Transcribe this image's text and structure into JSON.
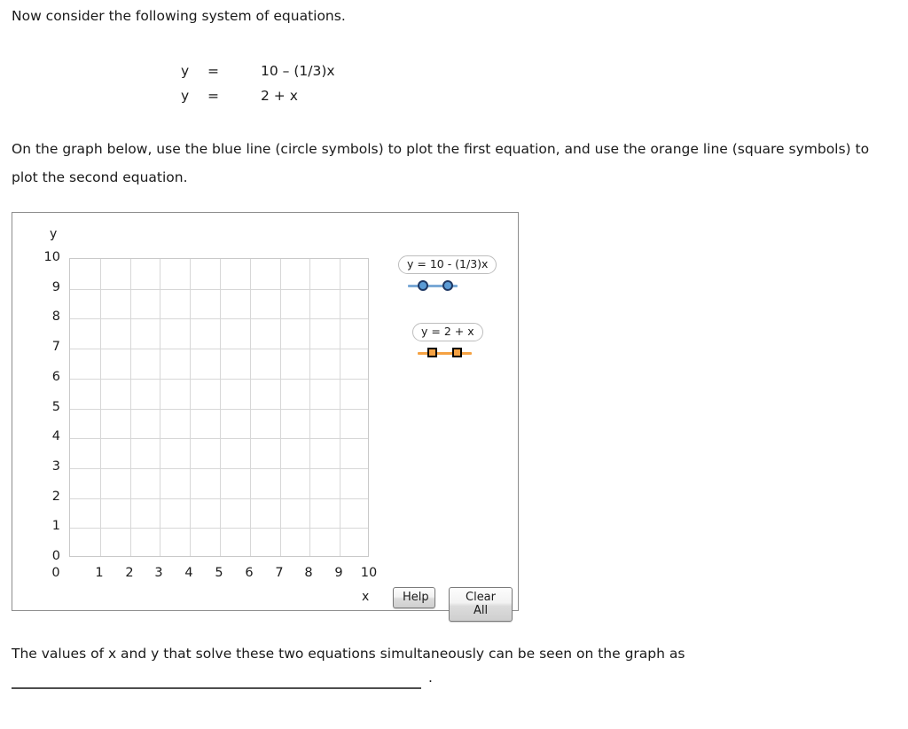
{
  "intro": {
    "text": "Now consider the following system of equations."
  },
  "equations": [
    {
      "lhs": "y",
      "eq": "=",
      "rhs": "10 – (1/3)x"
    },
    {
      "lhs": "y",
      "eq": "=",
      "rhs": "2 + x"
    }
  ],
  "instruction": {
    "text": "On the graph below, use the blue line (circle symbols) to plot the first equation, and use the orange line (square symbols) to plot the second equation."
  },
  "graph": {
    "axis_title_y": "y",
    "axis_title_x": "x",
    "y_ticks": [
      "10",
      "9",
      "8",
      "7",
      "6",
      "5",
      "4",
      "3",
      "2",
      "1",
      "0"
    ],
    "x_ticks": [
      "0",
      "1",
      "2",
      "3",
      "4",
      "5",
      "6",
      "7",
      "8",
      "9",
      "10"
    ],
    "legend": [
      {
        "label": "y = 10 - (1/3)x",
        "marker": "circle",
        "line_color": "#7aa9d6",
        "marker_fill": "#5b9bd5",
        "marker_border": "#1f3864"
      },
      {
        "label": "y = 2 + x",
        "marker": "square",
        "line_color": "#f5a142",
        "marker_fill": "#f5a142",
        "marker_border": "#000000"
      }
    ],
    "buttons": {
      "help_label": "Help",
      "clear_all_label": "Clear All"
    }
  },
  "closing": {
    "text": "The values of x and y that solve these two equations simultaneously can be seen on the graph as",
    "period": "."
  },
  "chart_data": {
    "type": "line",
    "title": "",
    "xlabel": "x",
    "ylabel": "y",
    "xlim": [
      0,
      10
    ],
    "ylim": [
      0,
      10
    ],
    "xticks": [
      0,
      1,
      2,
      3,
      4,
      5,
      6,
      7,
      8,
      9,
      10
    ],
    "yticks": [
      0,
      1,
      2,
      3,
      4,
      5,
      6,
      7,
      8,
      9,
      10
    ],
    "grid": true,
    "legend_position": "right",
    "series": [
      {
        "name": "y = 10 - (1/3)x",
        "marker": "circle",
        "color": "#5b9bd5",
        "x": [],
        "y": []
      },
      {
        "name": "y = 2 + x",
        "marker": "square",
        "color": "#f5a142",
        "x": [],
        "y": []
      }
    ]
  }
}
